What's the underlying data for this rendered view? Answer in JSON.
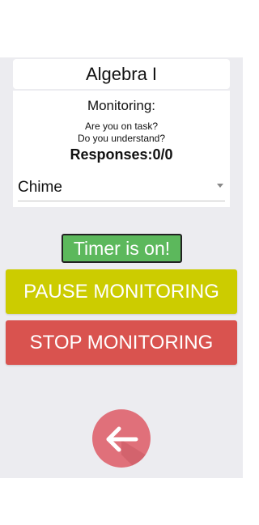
{
  "class_title": "Algebra I",
  "monitoring": {
    "label": "Monitoring:",
    "question_1": "Are you on task?",
    "question_2": "Do you understand?",
    "responses": "Responses:0/0"
  },
  "sound_select": {
    "value": "Chime",
    "icon": "chevron-down-icon"
  },
  "timer": {
    "status": "Timer is on!"
  },
  "actions": {
    "pause_label": "PAUSE MONITORING",
    "stop_label": "STOP MONITORING"
  },
  "back_button": {
    "icon": "arrow-left-icon"
  },
  "colors": {
    "background": "#ececf0",
    "timer": "#5cb85c",
    "pause": "#cccc00",
    "stop": "#d9534f",
    "back": "#e0707a"
  }
}
